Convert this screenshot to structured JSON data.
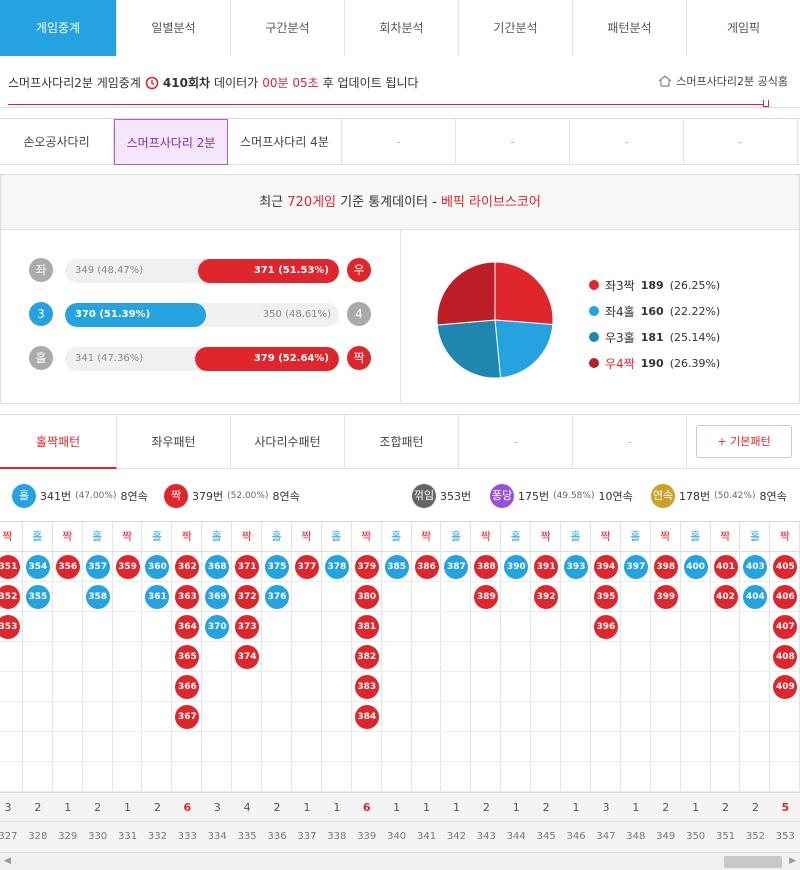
{
  "topnav": [
    "게임중계",
    "일별분석",
    "구간분석",
    "회차분석",
    "기간분석",
    "패턴분석",
    "게임픽"
  ],
  "info": {
    "prefix": "스머프사다리2분 게임중계",
    "round": "410회차",
    "mid": "데이터가",
    "time": "00분 05초",
    "suffix": "후 업데이트 됩니다",
    "home_link": "스머프사다리2분 공식홈"
  },
  "games": [
    "손오공사다리",
    "스머프사다리 2분",
    "스머프사다리 4분",
    "-",
    "-",
    "-",
    "-"
  ],
  "stats": {
    "title_prefix": "최근 ",
    "title_count": "720게임",
    "title_mid": " 기준 통계데이터 - ",
    "title_source": "베픽 라이브스코어",
    "rows": [
      {
        "left": "좌",
        "right": "우",
        "l_text": "349 (48.47%)",
        "r_text": "371 (51.53%)",
        "winner": "right",
        "pct": 51.53,
        "color": "#e0262d",
        "lcolor": "#aaa",
        "rcolor": "#e0262d"
      },
      {
        "left": "3",
        "right": "4",
        "l_text": "370 (51.39%)",
        "r_text": "350 (48.61%)",
        "winner": "left",
        "pct": 51.39,
        "color": "#24a3e0",
        "lcolor": "#24a3e0",
        "rcolor": "#aaa"
      },
      {
        "left": "홀",
        "right": "짝",
        "l_text": "341 (47.36%)",
        "r_text": "379 (52.64%)",
        "winner": "right",
        "pct": 52.64,
        "color": "#e0262d",
        "lcolor": "#aaa",
        "rcolor": "#e0262d"
      }
    ],
    "pie": [
      {
        "label": "좌3짝",
        "count": "189",
        "pct": "(26.25%)",
        "value": 26.25,
        "color": "#e0262d",
        "text_color": "#333"
      },
      {
        "label": "좌4홀",
        "count": "160",
        "pct": "(22.22%)",
        "value": 22.22,
        "color": "#24a3e0",
        "text_color": "#333"
      },
      {
        "label": "우3홀",
        "count": "181",
        "pct": "(25.14%)",
        "value": 25.14,
        "color": "#1f86b0",
        "text_color": "#333"
      },
      {
        "label": "우4짝",
        "count": "190",
        "pct": "(26.39%)",
        "value": 26.39,
        "color": "#bd1f26",
        "text_color": "#e0262d"
      }
    ]
  },
  "ptabs": [
    "홀짝패턴",
    "좌우패턴",
    "사다리수패턴",
    "조합패턴",
    "-",
    "-"
  ],
  "basic_btn": "+ 기본패턴",
  "summary": {
    "odd": {
      "badge": "홀",
      "text": "341번",
      "pct": "(47.00%)",
      "streak": "8연속"
    },
    "even": {
      "badge": "짝",
      "text": "379번",
      "pct": "(52.00%)",
      "streak": "8연속"
    },
    "break": {
      "badge": "꺾임",
      "text": "353번"
    },
    "pong": {
      "badge": "퐁당",
      "text": "175번",
      "pct": "(49.58%)",
      "streak": "10연속"
    },
    "cont": {
      "badge": "연속",
      "text": "178번",
      "pct": "(50.42%)",
      "streak": "8연속"
    }
  },
  "columns": [
    {
      "h": "짝",
      "nums": [
        "351",
        "352",
        "353"
      ],
      "count": "3",
      "round": "327"
    },
    {
      "h": "홀",
      "nums": [
        "354",
        "355"
      ],
      "count": "2",
      "round": "328"
    },
    {
      "h": "짝",
      "nums": [
        "356"
      ],
      "count": "1",
      "round": "329"
    },
    {
      "h": "홀",
      "nums": [
        "357",
        "358"
      ],
      "count": "2",
      "round": "330"
    },
    {
      "h": "짝",
      "nums": [
        "359"
      ],
      "count": "1",
      "round": "331"
    },
    {
      "h": "홀",
      "nums": [
        "360",
        "361"
      ],
      "count": "2",
      "round": "332"
    },
    {
      "h": "짝",
      "nums": [
        "362",
        "363",
        "364",
        "365",
        "366",
        "367"
      ],
      "count": "6",
      "round": "333"
    },
    {
      "h": "홀",
      "nums": [
        "368",
        "369",
        "370"
      ],
      "count": "3",
      "round": "334"
    },
    {
      "h": "짝",
      "nums": [
        "371",
        "372",
        "373",
        "374"
      ],
      "count": "4",
      "round": "335"
    },
    {
      "h": "홀",
      "nums": [
        "375",
        "376"
      ],
      "count": "2",
      "round": "336"
    },
    {
      "h": "짝",
      "nums": [
        "377"
      ],
      "count": "1",
      "round": "337"
    },
    {
      "h": "홀",
      "nums": [
        "378"
      ],
      "count": "1",
      "round": "338"
    },
    {
      "h": "짝",
      "nums": [
        "379",
        "380",
        "381",
        "382",
        "383",
        "384"
      ],
      "count": "6",
      "round": "339"
    },
    {
      "h": "홀",
      "nums": [
        "385"
      ],
      "count": "1",
      "round": "340"
    },
    {
      "h": "짝",
      "nums": [
        "386"
      ],
      "count": "1",
      "round": "341"
    },
    {
      "h": "홀",
      "nums": [
        "387"
      ],
      "count": "1",
      "round": "342"
    },
    {
      "h": "짝",
      "nums": [
        "388",
        "389"
      ],
      "count": "2",
      "round": "343"
    },
    {
      "h": "홀",
      "nums": [
        "390"
      ],
      "count": "1",
      "round": "344"
    },
    {
      "h": "짝",
      "nums": [
        "391",
        "392"
      ],
      "count": "2",
      "round": "345"
    },
    {
      "h": "홀",
      "nums": [
        "393"
      ],
      "count": "1",
      "round": "346"
    },
    {
      "h": "짝",
      "nums": [
        "394",
        "395",
        "396"
      ],
      "count": "3",
      "round": "347"
    },
    {
      "h": "홀",
      "nums": [
        "397"
      ],
      "count": "1",
      "round": "348"
    },
    {
      "h": "짝",
      "nums": [
        "398",
        "399"
      ],
      "count": "2",
      "round": "349"
    },
    {
      "h": "홀",
      "nums": [
        "400"
      ],
      "count": "1",
      "round": "350"
    },
    {
      "h": "짝",
      "nums": [
        "401",
        "402"
      ],
      "count": "2",
      "round": "351"
    },
    {
      "h": "홀",
      "nums": [
        "403",
        "404"
      ],
      "count": "2",
      "round": "352"
    },
    {
      "h": "짝",
      "nums": [
        "405",
        "406",
        "407",
        "408",
        "409"
      ],
      "count": "5",
      "round": "353"
    }
  ],
  "colors": {
    "odd": "#24a3e0",
    "even": "#e0262d",
    "break": "#666666",
    "pong": "#9b51d6",
    "cont": "#c9a227",
    "accent": "#24a3e0"
  }
}
